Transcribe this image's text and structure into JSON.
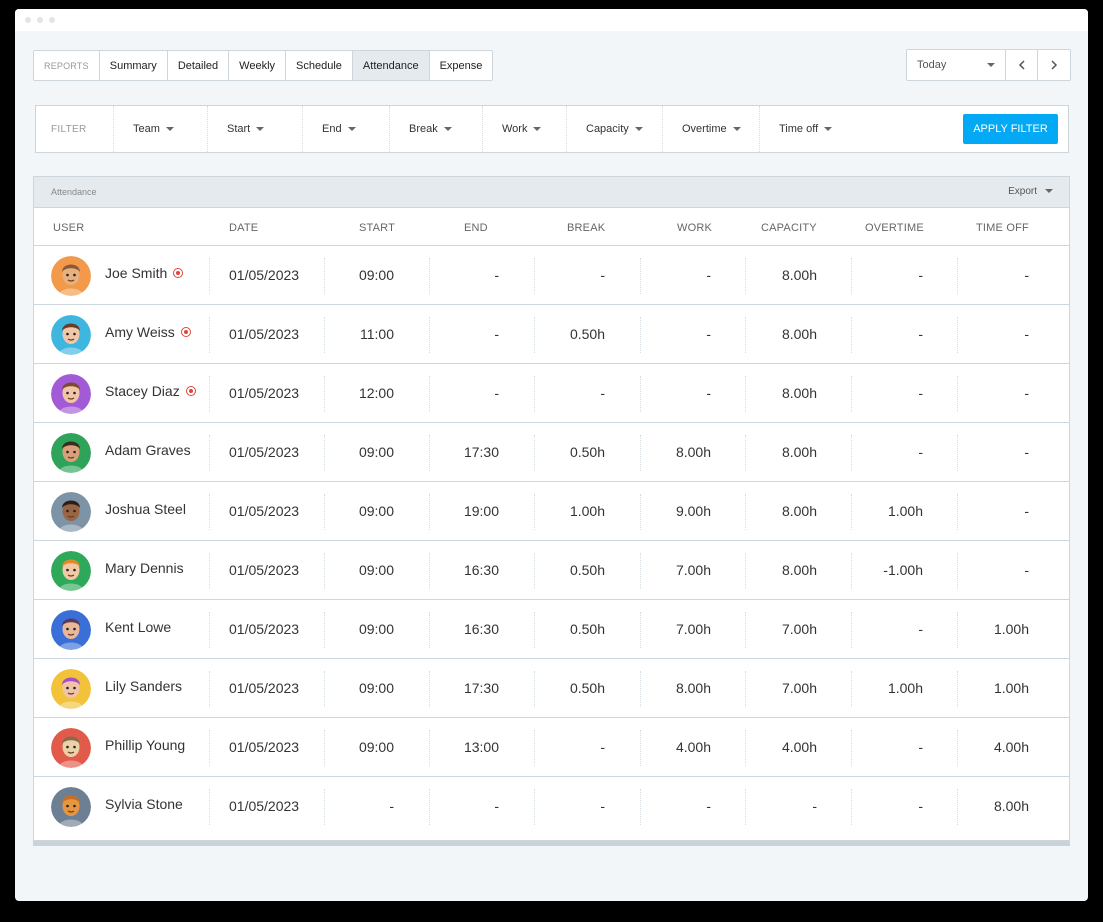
{
  "tabs": {
    "reports_label": "REPORTS",
    "items": [
      "Summary",
      "Detailed",
      "Weekly",
      "Schedule",
      "Attendance",
      "Expense"
    ],
    "active": "Attendance"
  },
  "datenav": {
    "selected": "Today"
  },
  "filter": {
    "label": "FILTER",
    "items": [
      "Team",
      "Start",
      "End",
      "Break",
      "Work",
      "Capacity",
      "Overtime",
      "Time off"
    ],
    "apply_label": "APPLY FILTER"
  },
  "attendance": {
    "title": "Attendance",
    "export_label": "Export",
    "columns": [
      "USER",
      "DATE",
      "START",
      "END",
      "BREAK",
      "WORK",
      "CAPACITY",
      "OVERTIME",
      "TIME OFF"
    ],
    "rows": [
      {
        "user": "Joe Smith",
        "recording": true,
        "date": "01/05/2023",
        "start": "09:00",
        "end": "-",
        "break": "-",
        "work": "-",
        "capacity": "8.00h",
        "overtime": "-",
        "time_off": "-",
        "avatar_bg": "#f39a4a",
        "avatar_skin": "#e7b07d",
        "avatar_hair": "#8a5a3a"
      },
      {
        "user": "Amy Weiss",
        "recording": true,
        "date": "01/05/2023",
        "start": "11:00",
        "end": "-",
        "break": "0.50h",
        "work": "-",
        "capacity": "8.00h",
        "overtime": "-",
        "time_off": "-",
        "avatar_bg": "#3fb6e0",
        "avatar_skin": "#f1c7a8",
        "avatar_hair": "#6b3b2a"
      },
      {
        "user": "Stacey Diaz",
        "recording": true,
        "date": "01/05/2023",
        "start": "12:00",
        "end": "-",
        "break": "-",
        "work": "-",
        "capacity": "8.00h",
        "overtime": "-",
        "time_off": "-",
        "avatar_bg": "#a35ad6",
        "avatar_skin": "#f0c6a6",
        "avatar_hair": "#7b4a30"
      },
      {
        "user": "Adam Graves",
        "recording": false,
        "date": "01/05/2023",
        "start": "09:00",
        "end": "17:30",
        "break": "0.50h",
        "work": "8.00h",
        "capacity": "8.00h",
        "overtime": "-",
        "time_off": "-",
        "avatar_bg": "#2fa35a",
        "avatar_skin": "#d9a07a",
        "avatar_hair": "#3a2a20"
      },
      {
        "user": "Joshua Steel",
        "recording": false,
        "date": "01/05/2023",
        "start": "09:00",
        "end": "19:00",
        "break": "1.00h",
        "work": "9.00h",
        "capacity": "8.00h",
        "overtime": "1.00h",
        "time_off": "-",
        "avatar_bg": "#7d93a6",
        "avatar_skin": "#9a6545",
        "avatar_hair": "#2a1e18"
      },
      {
        "user": "Mary Dennis",
        "recording": false,
        "date": "01/05/2023",
        "start": "09:00",
        "end": "16:30",
        "break": "0.50h",
        "work": "7.00h",
        "capacity": "8.00h",
        "overtime": "-1.00h",
        "time_off": "-",
        "avatar_bg": "#2ea95a",
        "avatar_skin": "#f3c9a3",
        "avatar_hair": "#e08a2c"
      },
      {
        "user": "Kent Lowe",
        "recording": false,
        "date": "01/05/2023",
        "start": "09:00",
        "end": "16:30",
        "break": "0.50h",
        "work": "7.00h",
        "capacity": "7.00h",
        "overtime": "-",
        "time_off": "1.00h",
        "avatar_bg": "#3a6fd8",
        "avatar_skin": "#e9b89a",
        "avatar_hair": "#5a3a5a"
      },
      {
        "user": "Lily Sanders",
        "recording": false,
        "date": "01/05/2023",
        "start": "09:00",
        "end": "17:30",
        "break": "0.50h",
        "work": "8.00h",
        "capacity": "7.00h",
        "overtime": "1.00h",
        "time_off": "1.00h",
        "avatar_bg": "#f2c23a",
        "avatar_skin": "#f1c4a8",
        "avatar_hair": "#a84fc4"
      },
      {
        "user": "Phillip Young",
        "recording": false,
        "date": "01/05/2023",
        "start": "09:00",
        "end": "13:00",
        "break": "-",
        "work": "4.00h",
        "capacity": "4.00h",
        "overtime": "-",
        "time_off": "4.00h",
        "avatar_bg": "#e25a4a",
        "avatar_skin": "#e9d2a8",
        "avatar_hair": "#8a6a4a"
      },
      {
        "user": "Sylvia Stone",
        "recording": false,
        "date": "01/05/2023",
        "start": "-",
        "end": "-",
        "break": "-",
        "work": "-",
        "capacity": "-",
        "overtime": "-",
        "time_off": "8.00h",
        "avatar_bg": "#6d7f92",
        "avatar_skin": "#e8963e",
        "avatar_hair": "#c56f26"
      }
    ]
  }
}
